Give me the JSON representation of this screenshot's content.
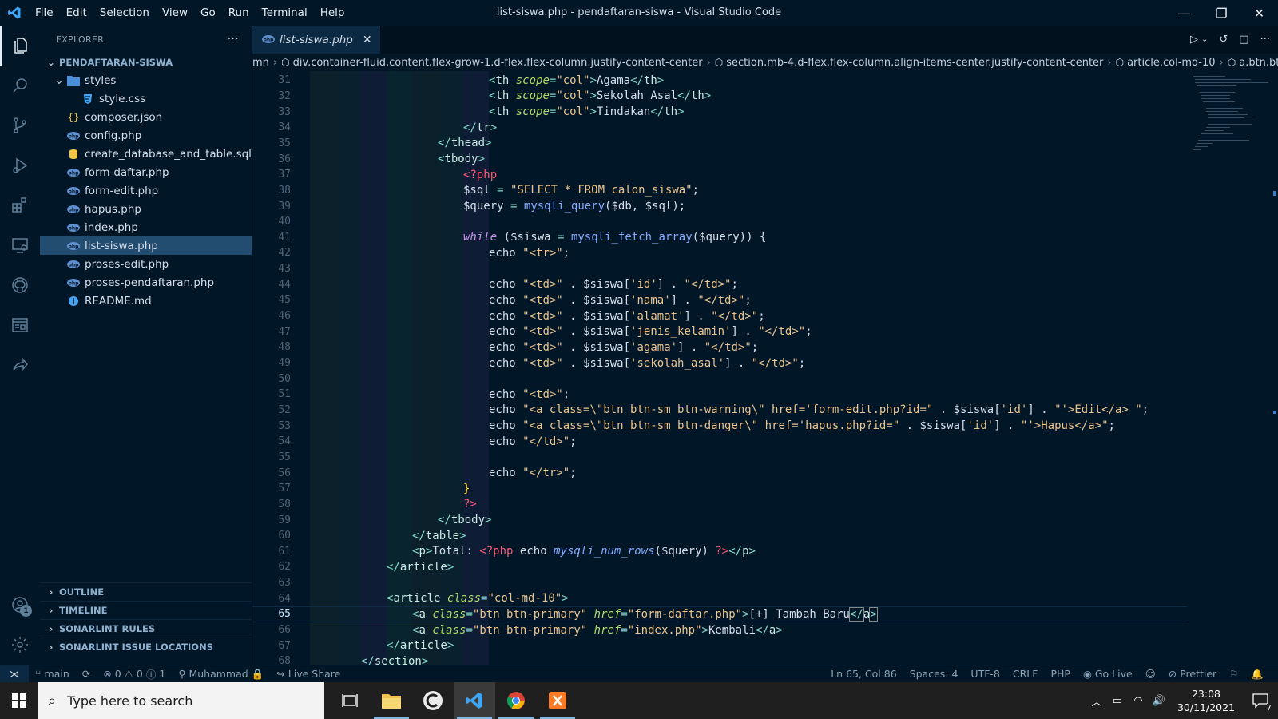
{
  "window": {
    "title": "list-siswa.php - pendaftaran-siswa - Visual Studio Code"
  },
  "menu": [
    "File",
    "Edit",
    "Selection",
    "View",
    "Go",
    "Run",
    "Terminal",
    "Help"
  ],
  "explorer": {
    "title": "EXPLORER",
    "more": "···",
    "root": "PENDAFTARAN-SISWA",
    "folder": "styles",
    "files": [
      {
        "name": "style.css",
        "icon": "css",
        "indent": 2
      },
      {
        "name": "composer.json",
        "icon": "json",
        "indent": 1
      },
      {
        "name": "config.php",
        "icon": "php",
        "indent": 1
      },
      {
        "name": "create_database_and_table.sql",
        "icon": "sql",
        "indent": 1
      },
      {
        "name": "form-daftar.php",
        "icon": "php",
        "indent": 1
      },
      {
        "name": "form-edit.php",
        "icon": "php",
        "indent": 1
      },
      {
        "name": "hapus.php",
        "icon": "php",
        "indent": 1
      },
      {
        "name": "index.php",
        "icon": "php",
        "indent": 1
      },
      {
        "name": "list-siswa.php",
        "icon": "php",
        "indent": 1,
        "selected": true
      },
      {
        "name": "proses-edit.php",
        "icon": "php",
        "indent": 1
      },
      {
        "name": "proses-pendaftaran.php",
        "icon": "php",
        "indent": 1
      },
      {
        "name": "README.md",
        "icon": "info",
        "indent": 1
      }
    ],
    "panels": [
      "OUTLINE",
      "TIMELINE",
      "SONARLINT RULES",
      "SONARLINT ISSUE LOCATIONS"
    ]
  },
  "tab": {
    "label": "list-siswa.php"
  },
  "breadcrumb": [
    "mn",
    "div.container-fluid.content.flex-grow-1.d-flex.flex-column.justify-content-center",
    "section.mb-4.d-flex.flex-column.align-items-center.justify-content-center",
    "article.col-md-10",
    "a.btn.btn-primary"
  ],
  "code": {
    "current_line": 65,
    "lines": [
      {
        "n": 31,
        "indent": 7,
        "html": "<span class='ang'>&lt;</span><span class='tag'>th</span> <span class='attr'>scope</span><span class='punc'>=</span><span class='str'>\"col\"</span><span class='ang'>&gt;</span>Agama<span class='ang'>&lt;/</span><span class='tag'>th</span><span class='ang'>&gt;</span>"
      },
      {
        "n": 32,
        "indent": 7,
        "html": "<span class='ang'>&lt;</span><span class='tag'>th</span> <span class='attr'>scope</span><span class='punc'>=</span><span class='str'>\"col\"</span><span class='ang'>&gt;</span>Sekolah Asal<span class='ang'>&lt;/</span><span class='tag'>th</span><span class='ang'>&gt;</span>"
      },
      {
        "n": 33,
        "indent": 7,
        "html": "<span class='ang'>&lt;</span><span class='tag'>th</span> <span class='attr'>scope</span><span class='punc'>=</span><span class='str'>\"col\"</span><span class='ang'>&gt;</span>Tindakan<span class='ang'>&lt;/</span><span class='tag'>th</span><span class='ang'>&gt;</span>"
      },
      {
        "n": 34,
        "indent": 6,
        "html": "<span class='ang'>&lt;/</span><span class='tag'>tr</span><span class='ang'>&gt;</span>"
      },
      {
        "n": 35,
        "indent": 5,
        "html": "<span class='ang'>&lt;/</span><span class='tag'>thead</span><span class='ang'>&gt;</span>"
      },
      {
        "n": 36,
        "indent": 5,
        "html": "<span class='ang'>&lt;</span><span class='tag'>tbody</span><span class='ang'>&gt;</span>"
      },
      {
        "n": 37,
        "indent": 6,
        "html": "<span class='php'>&lt;?php</span>"
      },
      {
        "n": 38,
        "indent": 6,
        "html": "<span class='var'>$sql</span> <span class='punc'>=</span> <span class='str'>\"SELECT * FROM calon_siswa\"</span>;"
      },
      {
        "n": 39,
        "indent": 6,
        "html": "<span class='var'>$query</span> <span class='punc'>=</span> <span class='fn'>mysqli_query</span>(<span class='var'>$db</span>, <span class='var'>$sql</span>);"
      },
      {
        "n": 40,
        "indent": 0,
        "html": ""
      },
      {
        "n": 41,
        "indent": 6,
        "html": "<span class='kw'>while</span> (<span class='var'>$siswa</span> <span class='punc'>=</span> <span class='fn'>mysqli_fetch_array</span>(<span class='var'>$query</span>)) <span class='ecc'>{</span>"
      },
      {
        "n": 42,
        "indent": 7,
        "html": "echo <span class='str'>\"&lt;tr&gt;\"</span>;"
      },
      {
        "n": 43,
        "indent": 0,
        "html": ""
      },
      {
        "n": 44,
        "indent": 7,
        "html": "echo <span class='str'>\"&lt;td&gt;\"</span> . <span class='var'>$siswa</span>[<span class='str'>'id'</span>] . <span class='str'>\"&lt;/td&gt;\"</span>;"
      },
      {
        "n": 45,
        "indent": 7,
        "html": "echo <span class='str'>\"&lt;td&gt;\"</span> . <span class='var'>$siswa</span>[<span class='str'>'nama'</span>] . <span class='str'>\"&lt;/td&gt;\"</span>;"
      },
      {
        "n": 46,
        "indent": 7,
        "html": "echo <span class='str'>\"&lt;td&gt;\"</span> . <span class='var'>$siswa</span>[<span class='str'>'alamat'</span>] . <span class='str'>\"&lt;/td&gt;\"</span>;"
      },
      {
        "n": 47,
        "indent": 7,
        "html": "echo <span class='str'>\"&lt;td&gt;\"</span> . <span class='var'>$siswa</span>[<span class='str'>'jenis_kelamin'</span>] . <span class='str'>\"&lt;/td&gt;\"</span>;"
      },
      {
        "n": 48,
        "indent": 7,
        "html": "echo <span class='str'>\"&lt;td&gt;\"</span> . <span class='var'>$siswa</span>[<span class='str'>'agama'</span>] . <span class='str'>\"&lt;/td&gt;\"</span>;"
      },
      {
        "n": 49,
        "indent": 7,
        "html": "echo <span class='str'>\"&lt;td&gt;\"</span> . <span class='var'>$siswa</span>[<span class='str'>'sekolah_asal'</span>] . <span class='str'>\"&lt;/td&gt;\"</span>;"
      },
      {
        "n": 50,
        "indent": 0,
        "html": ""
      },
      {
        "n": 51,
        "indent": 7,
        "html": "echo <span class='str'>\"&lt;td&gt;\"</span>;"
      },
      {
        "n": 52,
        "indent": 7,
        "html": "echo <span class='str'>\"&lt;a class=\\\"btn btn-sm btn-warning\\\" href='form-edit.php?id=\"</span> . <span class='var'>$siswa</span>[<span class='str'>'id'</span>] . <span class='str'>\"'&gt;Edit&lt;/a&gt; \"</span>;"
      },
      {
        "n": 53,
        "indent": 7,
        "html": "echo <span class='str'>\"&lt;a class=\\\"btn btn-sm btn-danger\\\" href='hapus.php?id=\"</span> . <span class='var'>$siswa</span>[<span class='str'>'id'</span>] . <span class='str'>\"'&gt;Hapus&lt;/a&gt;\"</span>;"
      },
      {
        "n": 54,
        "indent": 7,
        "html": "echo <span class='str'>\"&lt;/td&gt;\"</span>;"
      },
      {
        "n": 55,
        "indent": 0,
        "html": ""
      },
      {
        "n": 56,
        "indent": 7,
        "html": "echo <span class='str'>\"&lt;/tr&gt;\"</span>;"
      },
      {
        "n": 57,
        "indent": 6,
        "html": "<span style='color:#ffd700'>}</span>"
      },
      {
        "n": 58,
        "indent": 6,
        "html": "<span class='php'>?&gt;</span>"
      },
      {
        "n": 59,
        "indent": 5,
        "html": "<span class='ang'>&lt;/</span><span class='tag'>tbody</span><span class='ang'>&gt;</span>"
      },
      {
        "n": 60,
        "indent": 4,
        "html": "<span class='ang'>&lt;/</span><span class='tag'>table</span><span class='ang'>&gt;</span>"
      },
      {
        "n": 61,
        "indent": 4,
        "html": "<span class='ang'>&lt;</span><span class='tag'>p</span><span class='ang'>&gt;</span>Total: <span class='php'>&lt;?php</span> echo <span class='fni'>mysqli_num_rows</span>(<span class='var'>$query</span>) <span class='php'>?&gt;</span><span class='ang'>&lt;/</span><span class='tag'>p</span><span class='ang'>&gt;</span>"
      },
      {
        "n": 62,
        "indent": 3,
        "html": "<span class='ang'>&lt;/</span><span class='tag'>article</span><span class='ang'>&gt;</span>"
      },
      {
        "n": 63,
        "indent": 0,
        "html": ""
      },
      {
        "n": 64,
        "indent": 3,
        "html": "<span class='ang'>&lt;</span><span class='tag'>article</span> <span class='attr'>class</span><span class='punc'>=</span><span class='str'>\"col-md-10\"</span><span class='ang'>&gt;</span>"
      },
      {
        "n": 65,
        "indent": 4,
        "html": "<span class='ang'>&lt;</span><span class='tag'>a</span> <span class='attr'>class</span><span class='punc'>=</span><span class='str'>\"btn btn-primary\"</span> <span class='attr'>href</span><span class='punc'>=</span><span class='str'>\"form-daftar.php\"</span><span class='ang'>&gt;</span>[+] Tambah Baru<span class='ang' style='outline:1px solid #888'>&lt;/</span><span class='tag'>a</span><span class='ang' style='outline:1px solid #888'>&gt;</span>"
      },
      {
        "n": 66,
        "indent": 4,
        "html": "<span class='ang'>&lt;</span><span class='tag'>a</span> <span class='attr'>class</span><span class='punc'>=</span><span class='str'>\"btn btn-primary\"</span> <span class='attr'>href</span><span class='punc'>=</span><span class='str'>\"index.php\"</span><span class='ang'>&gt;</span>Kembali<span class='ang'>&lt;/</span><span class='tag'>a</span><span class='ang'>&gt;</span>"
      },
      {
        "n": 67,
        "indent": 3,
        "html": "<span class='ang'>&lt;/</span><span class='tag'>article</span><span class='ang'>&gt;</span>"
      },
      {
        "n": 68,
        "indent": 2,
        "html": "<span class='ang'>&lt;/</span><span class='tag'>section</span><span class='ang'>&gt;</span>"
      }
    ]
  },
  "status": {
    "branch": "main",
    "problems": "0",
    "warnings": "0",
    "info": "1",
    "user": "Muhammad",
    "liveshare": "Live Share",
    "position": "Ln 65, Col 86",
    "spaces": "Spaces: 4",
    "encoding": "UTF-8",
    "eol": "CRLF",
    "language": "PHP",
    "golive": "Go Live",
    "prettier": "Prettier"
  },
  "taskbar": {
    "search_placeholder": "Type here to search",
    "time": "23:08",
    "date": "30/11/2021",
    "notifications": "7"
  },
  "colors": {
    "bg": "#011627",
    "accent": "#5f7e97",
    "selection": "#234d70"
  }
}
